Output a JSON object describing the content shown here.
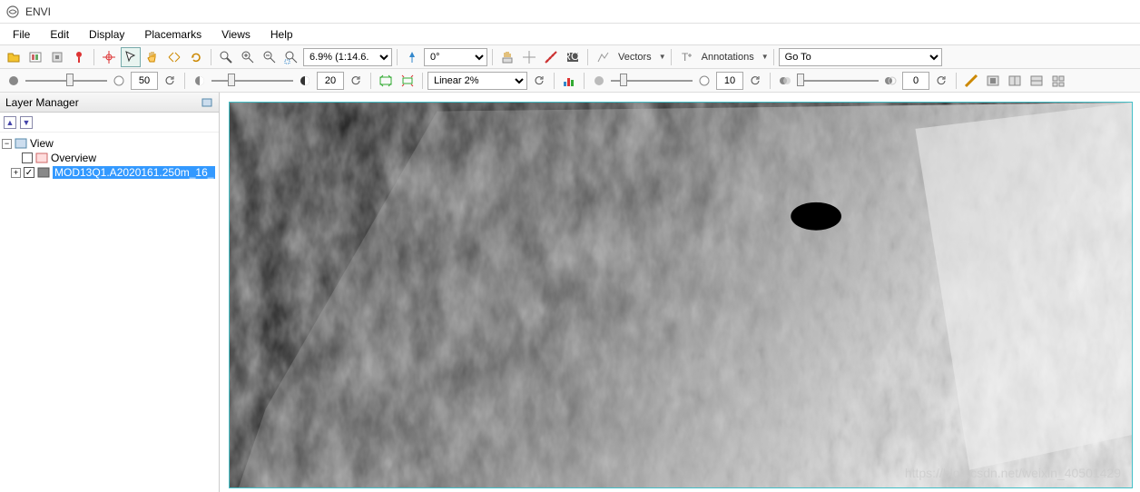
{
  "window": {
    "title": "ENVI"
  },
  "menu": {
    "items": [
      "File",
      "Edit",
      "Display",
      "Placemarks",
      "Views",
      "Help"
    ]
  },
  "toolbar1": {
    "zoom_combo": "6.9% (1:14.6.",
    "rotate_combo": "0°",
    "vectors_label": "Vectors",
    "annotations_label": "Annotations",
    "goto_label": "Go To"
  },
  "toolbar2": {
    "brightness_value": "50",
    "contrast_value": "20",
    "stretch_combo": "Linear 2%",
    "sharpen_value": "10",
    "transparency_value": "0"
  },
  "layer_panel": {
    "title": "Layer Manager",
    "root": "View",
    "overview": "Overview",
    "dataset": "MOD13Q1.A2020161.250m_16_"
  },
  "watermark": "https://blog.csdn.net/weixin_40501429"
}
